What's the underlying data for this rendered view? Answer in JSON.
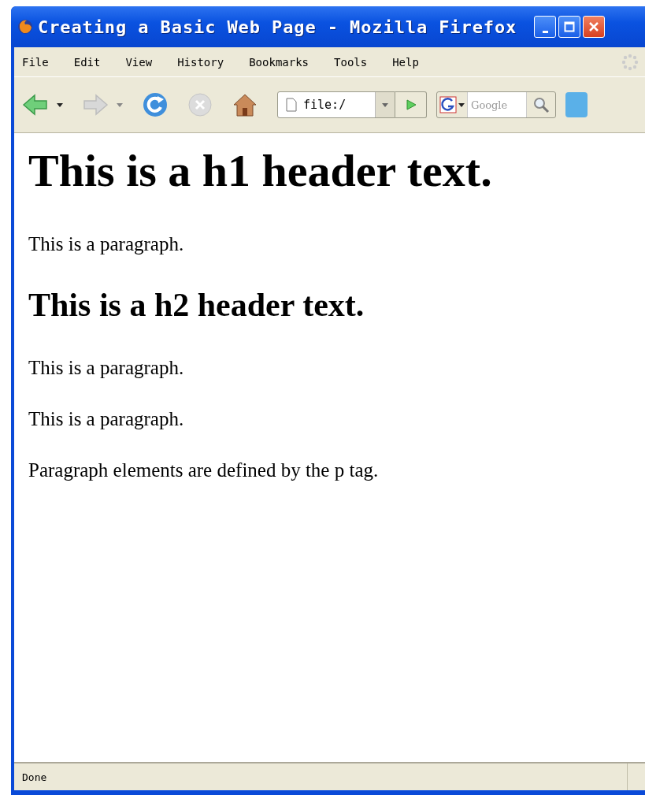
{
  "window": {
    "title": "Creating a Basic Web Page - Mozilla Firefox"
  },
  "menu": [
    "File",
    "Edit",
    "View",
    "History",
    "Bookmarks",
    "Tools",
    "Help"
  ],
  "address_bar": {
    "value": "file:/"
  },
  "search": {
    "placeholder": "Google"
  },
  "content": [
    {
      "kind": "h1",
      "text": "This is a h1 header text."
    },
    {
      "kind": "p",
      "text": "This is a paragraph."
    },
    {
      "kind": "h2",
      "text": "This is a h2 header text."
    },
    {
      "kind": "p",
      "text": "This is a paragraph."
    },
    {
      "kind": "p",
      "text": "This is a paragraph."
    },
    {
      "kind": "p",
      "text": "Paragraph elements are defined by the p tag."
    }
  ],
  "status_bar": {
    "text": "Done"
  }
}
